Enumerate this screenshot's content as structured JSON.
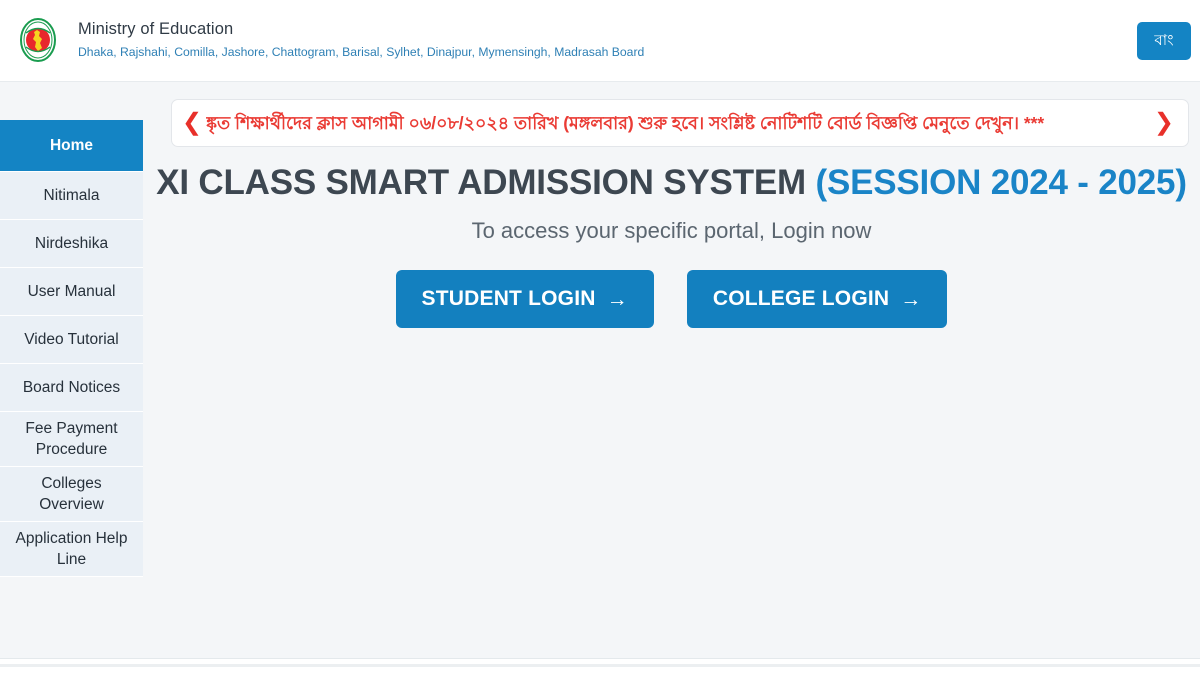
{
  "header": {
    "emblem_icon": "bangladesh-government-emblem-icon",
    "ministry_name": "Ministry of Education",
    "board_list": "Dhaka, Rajshahi, Comilla, Jashore, Chattogram, Barisal, Sylhet, Dinajpur, Mymensingh, Madrasah Board",
    "language_toggle_label": "বাং"
  },
  "sidebar": {
    "items": [
      {
        "label": "Home",
        "active": true
      },
      {
        "label": "Nitimala",
        "active": false
      },
      {
        "label": "Nirdeshika",
        "active": false
      },
      {
        "label": "User Manual",
        "active": false
      },
      {
        "label": "Video Tutorial",
        "active": false
      },
      {
        "label": "Board Notices",
        "active": false
      },
      {
        "label": "Fee Payment Procedure",
        "active": false
      },
      {
        "label": "Colleges Overview",
        "active": false
      },
      {
        "label": "Application Help Line",
        "active": false
      }
    ]
  },
  "notice": {
    "prev_icon": "chevron-left-icon",
    "next_icon": "chevron-right-icon",
    "text": "ঙ্কৃত শিক্ষার্থীদের ক্লাস আগামী ০৬/০৮/২০২৪ তারিখ (মঙ্গলবার) শুরু হবে। সংশ্লিষ্ট নোটিশটি বোর্ড বিজ্ঞপ্তি মেনুতে দেখুন। ***",
    "text_color": "#ea3b34"
  },
  "hero": {
    "title_main": "XI CLASS SMART ADMISSION SYSTEM",
    "title_session": "(SESSION 2024 - 2025)",
    "subtitle": "To access your specific portal, Login now",
    "student_login_label": "STUDENT LOGIN",
    "college_login_label": "COLLEGE LOGIN",
    "arrow_glyph": "→"
  },
  "colors": {
    "accent_blue": "#1484c4",
    "title_dark": "#3d4751",
    "notice_red": "#ea3b34",
    "sidebar_item_bg": "#eaf0f6",
    "page_bg": "#f4f6f8"
  }
}
